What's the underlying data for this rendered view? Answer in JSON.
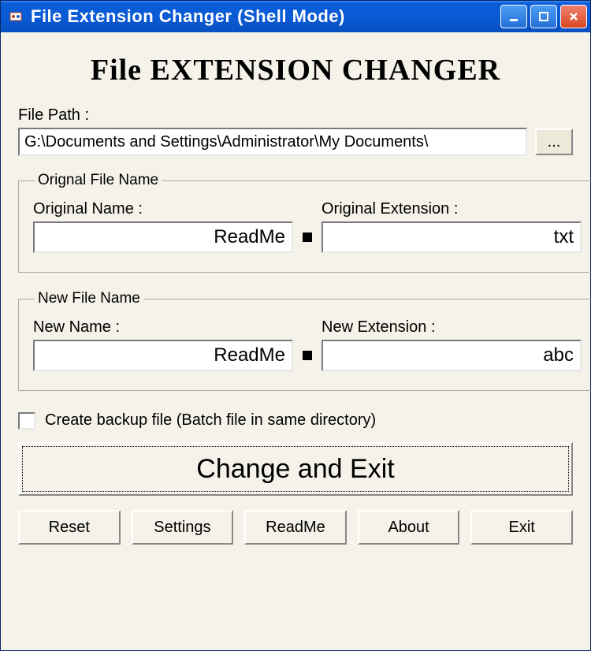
{
  "window": {
    "title": "File Extension Changer (Shell Mode)"
  },
  "app_title": "File EXTENSION CHANGER",
  "file_path": {
    "label": "File Path :",
    "value": "G:\\Documents and Settings\\Administrator\\My Documents\\",
    "browse_label": "..."
  },
  "original": {
    "legend": "Orignal File Name",
    "name_label": "Original Name :",
    "name_value": "ReadMe",
    "ext_label": "Original Extension :",
    "ext_value": "txt"
  },
  "new": {
    "legend": "New File Name",
    "name_label": "New Name :",
    "name_value": "ReadMe",
    "ext_label": "New Extension :",
    "ext_value": "abc"
  },
  "backup": {
    "checked": false,
    "label": "Create backup file (Batch file in same directory)"
  },
  "main_button": "Change and Exit",
  "buttons": {
    "reset": "Reset",
    "settings": "Settings",
    "readme": "ReadMe",
    "about": "About",
    "exit": "Exit"
  }
}
